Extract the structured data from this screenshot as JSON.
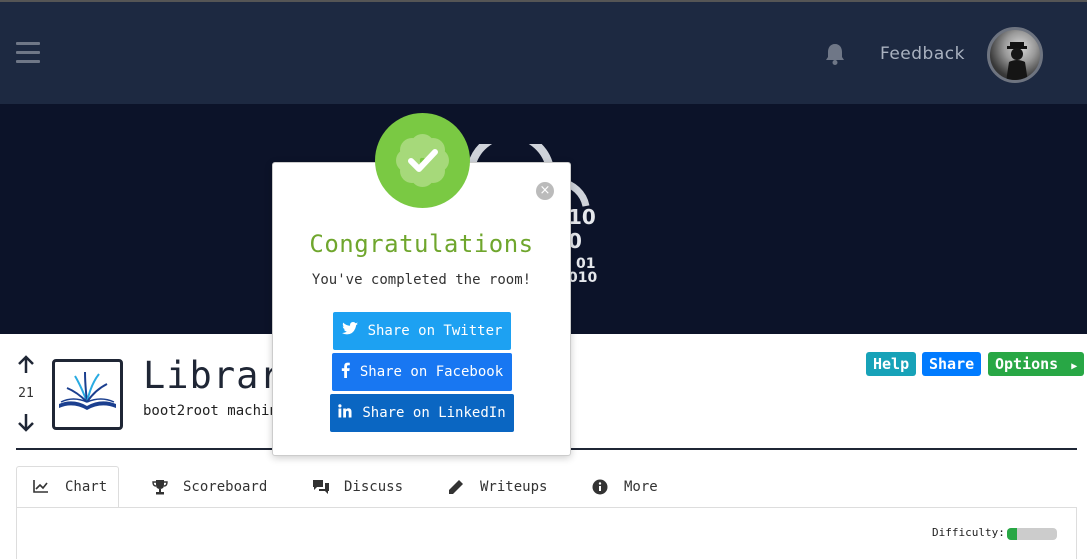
{
  "navbar": {
    "feedback_label": "Feedback"
  },
  "room": {
    "title": "Library",
    "subtitle": "boot2root machine",
    "vote_count": "21",
    "buttons": {
      "help": "Help",
      "share": "Share",
      "options": "Options"
    }
  },
  "tabs": [
    {
      "label": "Chart",
      "icon": "chart-line-icon"
    },
    {
      "label": "Scoreboard",
      "icon": "trophy-icon"
    },
    {
      "label": "Discuss",
      "icon": "comments-icon"
    },
    {
      "label": "Writeups",
      "icon": "pencil-icon"
    },
    {
      "label": "More",
      "icon": "info-circle-icon"
    }
  ],
  "difficulty": {
    "label": "Difficulty:",
    "level": 0.2
  },
  "hero": {
    "binary_lines": [
      "10",
      "0",
      "01",
      "010"
    ]
  },
  "modal": {
    "title": "Congratulations",
    "subtitle": "You've completed the room!",
    "close_label": "×",
    "share_twitter": "Share on Twitter",
    "share_facebook": "Share on Facebook",
    "share_linkedin": "Share on LinkedIn"
  },
  "colors": {
    "navbar": "#1d2941",
    "hero": "#0c1329",
    "badge": "#7ac943",
    "title": "#6fa62d",
    "twitter": "#1da1f2",
    "facebook": "#1877f2",
    "linkedin": "#0a66c2",
    "help": "#17a2b8",
    "share": "#007bff",
    "options": "#28a745"
  }
}
